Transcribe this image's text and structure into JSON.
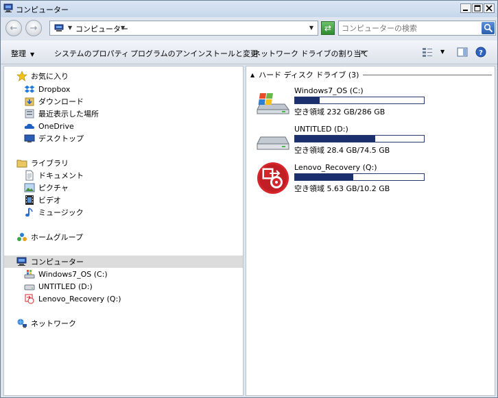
{
  "window": {
    "title": "コンピューター"
  },
  "navbar": {
    "address_text": "コンピューター",
    "search_placeholder": "コンピューターの検索"
  },
  "commandbar": {
    "organize": "整理",
    "system_properties": "システムのプロパティ",
    "uninstall": "プログラムのアンインストールと変更",
    "map_drive": "ネットワーク ドライブの割り当て",
    "more": "»"
  },
  "nav": {
    "favorites": {
      "label": "お気に入り",
      "items": [
        "Dropbox",
        "ダウンロード",
        "最近表示した場所",
        "OneDrive",
        "デスクトップ"
      ]
    },
    "libraries": {
      "label": "ライブラリ",
      "items": [
        "ドキュメント",
        "ピクチャ",
        "ビデオ",
        "ミュージック"
      ]
    },
    "homegroup": "ホームグループ",
    "computer": {
      "label": "コンピューター",
      "items": [
        "Windows7_OS (C:)",
        "UNTITLED (D:)",
        "Lenovo_Recovery (Q:)"
      ]
    },
    "network": "ネットワーク"
  },
  "content": {
    "group_header": "ハード ディスク ドライブ (3)",
    "drives": [
      {
        "name": "Windows7_OS (C:)",
        "free_text": "空き領域 232 GB/286 GB",
        "used_fraction": 0.19
      },
      {
        "name": "UNTITLED (D:)",
        "free_text": "空き領域 28.4 GB/74.5 GB",
        "used_fraction": 0.62
      },
      {
        "name": "Lenovo_Recovery (Q:)",
        "free_text": "空き領域 5.63 GB/10.2 GB",
        "used_fraction": 0.45
      }
    ]
  },
  "colors": {
    "drive_bar_fill": "#1b2f6e",
    "selection_bg": "#dcdcdc"
  }
}
